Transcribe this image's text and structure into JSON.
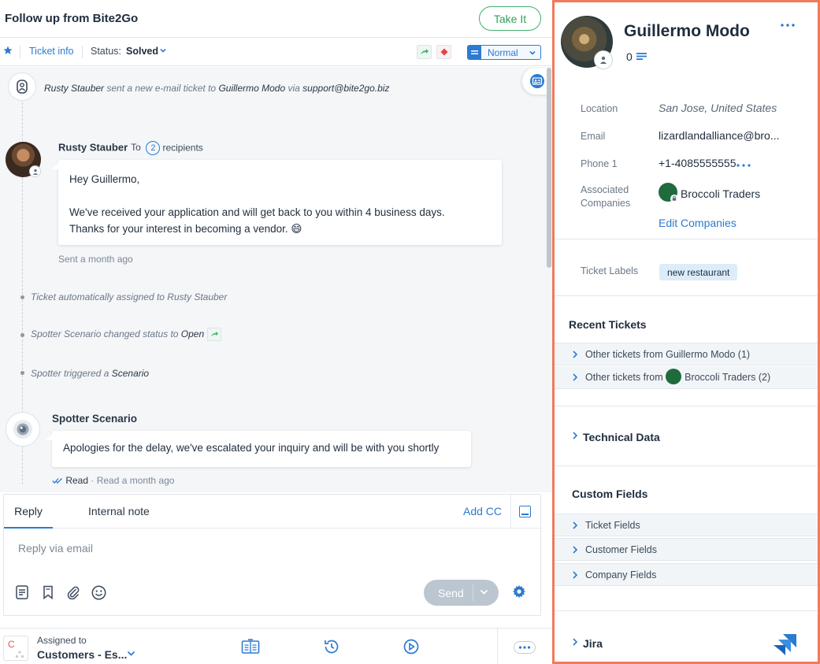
{
  "ticket": {
    "title": "Follow up from Bite2Go",
    "take_it": "Take It",
    "ticket_info": "Ticket info",
    "status_label": "Status:",
    "status_value": "Solved",
    "priority": "Normal"
  },
  "feed": {
    "sys_event": {
      "actor": "Rusty Stauber",
      "text1": " sent a new e-mail ticket to ",
      "target": "Guillermo Modo",
      "text2": " via ",
      "email": "support@bite2go.biz"
    },
    "message1": {
      "sender": "Rusty Stauber",
      "to": "To",
      "recipient_count": "2",
      "recipients": "recipients",
      "line1": "Hey Guillermo,",
      "line2": "We've received your application and will get back to you within 4 business days.",
      "line3": "Thanks for your interest in becoming a vendor. 😄",
      "sent": "Sent a month ago"
    },
    "events": {
      "assigned": "Ticket automatically assigned to Rusty Stauber",
      "status_prefix": "Spotter Scenario changed status to ",
      "status_value": "Open",
      "trigger_prefix": "Spotter triggered a ",
      "trigger_value": "Scenario"
    },
    "message2": {
      "sender": "Spotter Scenario",
      "body": "Apologies for the delay, we've escalated your inquiry and will be with you shortly",
      "read": "Read",
      "read_time": "Read a month ago"
    }
  },
  "composer": {
    "tab_reply": "Reply",
    "tab_note": "Internal note",
    "add_cc": "Add CC",
    "placeholder": "Reply via email",
    "send": "Send"
  },
  "footer": {
    "assigned_label": "Assigned to",
    "assigned_value": "Customers - Es...",
    "avatar_letter": "C"
  },
  "customer": {
    "name": "Guillermo Modo",
    "count": "0",
    "location_label": "Location",
    "location": "San Jose, United States",
    "email_label": "Email",
    "email": "lizardlandalliance@bro...",
    "phone_label": "Phone 1",
    "phone": "+1-4085555555",
    "companies_label": "Associated Companies",
    "company": "Broccoli Traders",
    "edit_companies": "Edit Companies",
    "labels_label": "Ticket Labels",
    "label_chip": "new restaurant"
  },
  "sections": {
    "recent_tickets": "Recent Tickets",
    "other_tickets_1": "Other tickets from Guillermo Modo (1)",
    "other_tickets_2_prefix": "Other tickets from ",
    "other_tickets_2_suffix": "Broccoli Traders (2)",
    "technical_data": "Technical Data",
    "custom_fields": "Custom Fields",
    "ticket_fields": "Ticket Fields",
    "customer_fields": "Customer Fields",
    "company_fields": "Company Fields",
    "jira": "Jira"
  },
  "colors": {
    "accent": "#2b7bd1",
    "take_it_green": "#3fb06b",
    "highlight_border": "#f07a5a"
  }
}
